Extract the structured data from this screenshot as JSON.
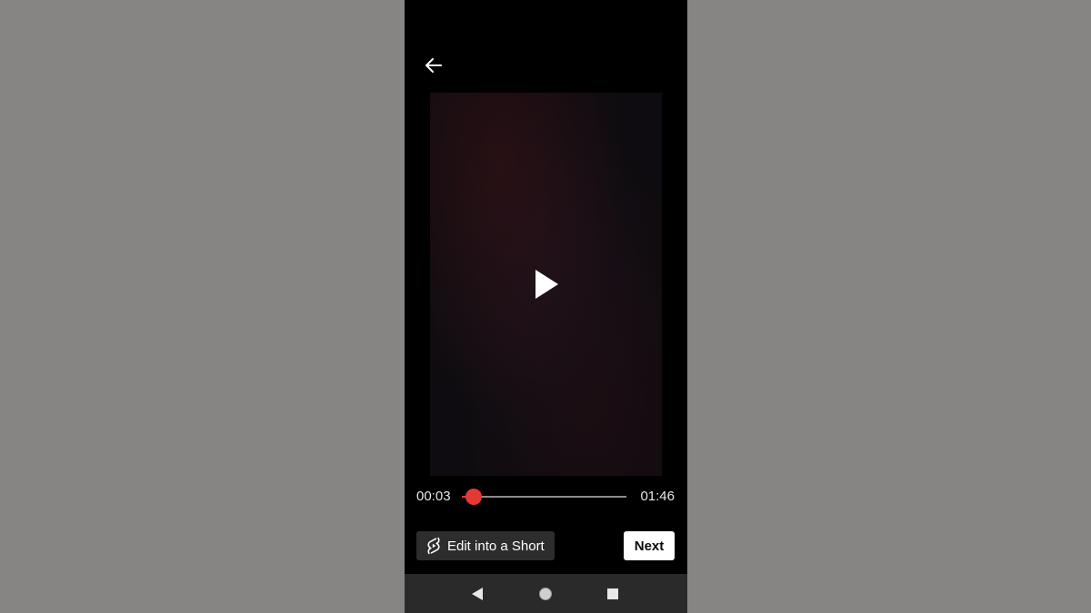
{
  "player": {
    "current_time": "00:03",
    "total_time": "01:46",
    "progress_fraction": 0.03
  },
  "actions": {
    "edit_short_label": "Edit into a Short",
    "next_label": "Next"
  },
  "icons": {
    "back": "arrow-left-icon",
    "play": "play-icon",
    "shorts": "shorts-logo-icon",
    "nav_back": "triangle-back-icon",
    "nav_home": "circle-home-icon",
    "nav_recent": "square-recent-icon"
  },
  "colors": {
    "accent": "#e53935",
    "background": "#000000",
    "nav_bar": "#2a2a2a"
  }
}
